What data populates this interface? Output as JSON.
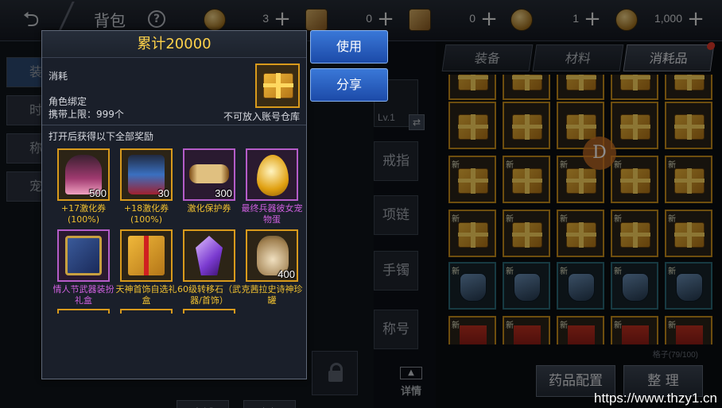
{
  "header": {
    "title": "背包",
    "help": "?",
    "currencies": [
      {
        "icon": "gold-coin-icon",
        "value": "3"
      },
      {
        "icon": "scroll-ticket-icon",
        "value": "0"
      },
      {
        "icon": "rune-scroll-icon",
        "value": "0"
      },
      {
        "icon": "medal-coin-icon",
        "value": "1"
      },
      {
        "icon": "crest-coin-icon",
        "value": "1,000"
      }
    ]
  },
  "background": {
    "side_tabs": [
      "装",
      "时",
      "称",
      "宠"
    ],
    "bottom_buttons": [
      "商城",
      "上架"
    ]
  },
  "equipment_slots": {
    "weapon_level": "Lv.1",
    "slots": [
      "戒指",
      "项链",
      "手镯",
      "称号"
    ],
    "detail_label": "详情"
  },
  "inventory": {
    "tabs": [
      "装备",
      "材料",
      "消耗品"
    ],
    "active_tab": "消耗品",
    "new_badge": "新",
    "capacity": "格子(79/100)",
    "buttons": [
      "药品配置",
      "整 理"
    ],
    "badge_letter": "D"
  },
  "popup": {
    "title": "累计20000",
    "type": "消耗",
    "bind": "角色绑定",
    "stack_limit": "携带上限：999个",
    "storage_note": "不可放入账号仓库",
    "rewards_title": "打开后获得以下全部奖励",
    "rewards": [
      {
        "name": "+17激化券(100%)",
        "count": "500",
        "rarity": "legendary",
        "art": "art-girl"
      },
      {
        "name": "+18激化券(100%)",
        "count": "30",
        "rarity": "legendary",
        "art": "art-armor"
      },
      {
        "name": "激化保护券",
        "count": "300",
        "rarity": "legendary",
        "art": "art-scroll"
      },
      {
        "name": "最终兵器彼女宠物蛋",
        "count": "",
        "rarity": "epic",
        "art": "art-egg"
      },
      {
        "name": "情人节武器装扮礼盒",
        "count": "",
        "rarity": "epic",
        "art": "art-chest"
      },
      {
        "name": "天神首饰自选礼盒",
        "count": "",
        "rarity": "legendary",
        "art": "art-gift"
      },
      {
        "name": "60级转移石（武器/首饰）",
        "count": "",
        "rarity": "legendary",
        "art": "art-crystal"
      },
      {
        "name": "克茜拉史诗神珍罐",
        "count": "400",
        "rarity": "legendary",
        "art": "art-urn"
      }
    ]
  },
  "actions": {
    "use": "使用",
    "share": "分享"
  },
  "watermark": "https://www.thzy1.cn",
  "colors": {
    "legendary_text": "#f0c030",
    "epic_text": "#d060e0",
    "title_gold": "#ffd24a",
    "button_blue": "#2a62c8"
  }
}
